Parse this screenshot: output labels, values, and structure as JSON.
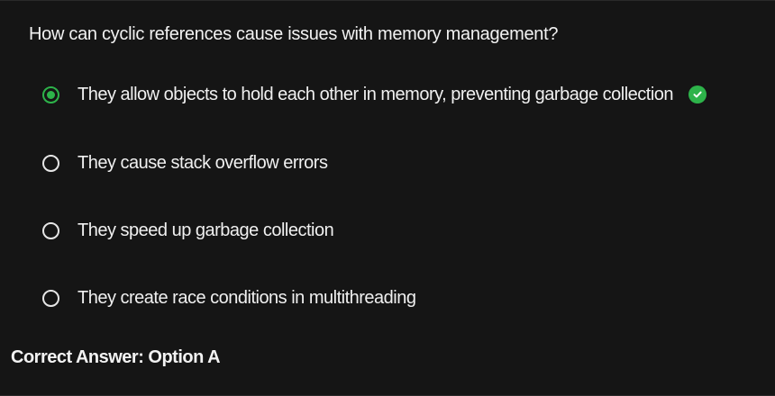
{
  "question": {
    "text": "How can cyclic references cause issues with memory management?"
  },
  "options": [
    {
      "label": "They allow objects to hold each other in memory, preventing garbage collection",
      "selected": true,
      "correct": true
    },
    {
      "label": "They cause stack overflow errors",
      "selected": false,
      "correct": false
    },
    {
      "label": "They speed up garbage collection",
      "selected": false,
      "correct": false
    },
    {
      "label": "They create race conditions in multithreading",
      "selected": false,
      "correct": false
    }
  ],
  "result": {
    "text": "Correct Answer: Option A"
  },
  "colors": {
    "background": "#151515",
    "accent_green": "#2db34a",
    "text": "#f2f2f2"
  },
  "icons": {
    "selected_radio": "radio-selected-icon",
    "unselected_radio": "radio-unselected-icon",
    "correct": "check-circle-icon"
  }
}
